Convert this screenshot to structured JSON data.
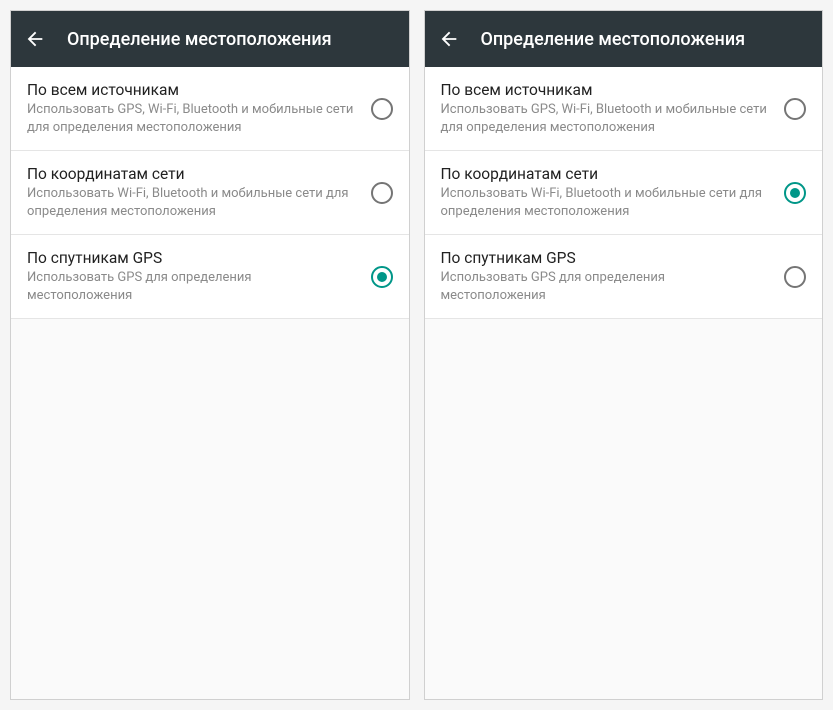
{
  "accent_color": "#009688",
  "screens": [
    {
      "title": "Определение местоположения",
      "options": [
        {
          "title": "По всем источникам",
          "subtitle": "Использовать GPS, Wi-Fi, Bluetooth и мобильные сети для определения местоположения",
          "selected": false
        },
        {
          "title": "По координатам сети",
          "subtitle": "Использовать Wi-Fi, Bluetooth и мобильные сети для определения местоположения",
          "selected": false
        },
        {
          "title": "По спутникам GPS",
          "subtitle": "Использовать GPS для определения местоположения",
          "selected": true
        }
      ]
    },
    {
      "title": "Определение местоположения",
      "options": [
        {
          "title": "По всем источникам",
          "subtitle": "Использовать GPS, Wi-Fi, Bluetooth и мобильные сети для определения местоположения",
          "selected": false
        },
        {
          "title": "По координатам сети",
          "subtitle": "Использовать Wi-Fi, Bluetooth и мобильные сети для определения местоположения",
          "selected": true
        },
        {
          "title": "По спутникам GPS",
          "subtitle": "Использовать GPS для определения местоположения",
          "selected": false
        }
      ]
    }
  ]
}
